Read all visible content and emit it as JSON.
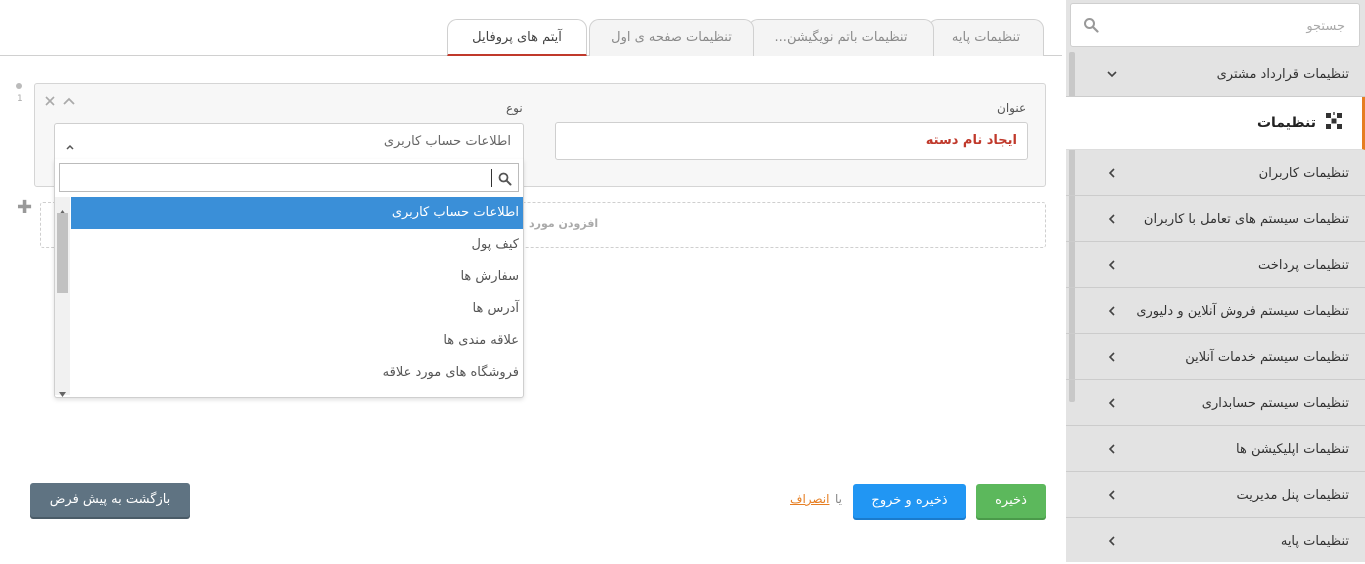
{
  "sidebar": {
    "search_placeholder": "جستجو",
    "items": [
      {
        "label": "تنظیمات قرارداد مشتری"
      },
      {
        "label": "تنظیمات"
      },
      {
        "label": "تنظیمات کاربران"
      },
      {
        "label": "تنظیمات سیستم های تعامل با کاربران"
      },
      {
        "label": "تنظیمات پرداخت"
      },
      {
        "label": "تنظیمات سیستم فروش آنلاین و دلیوری"
      },
      {
        "label": "تنظیمات سیستم خدمات آنلاین"
      },
      {
        "label": "تنظیمات سیستم حسابداری"
      },
      {
        "label": "تنظیمات اپلیکیشن ها"
      },
      {
        "label": "تنظیمات پنل مدیریت"
      },
      {
        "label": "تنظیمات پایه"
      }
    ],
    "accent_color": "#e67e22"
  },
  "tabs": [
    {
      "label": "تنظیمات پایه"
    },
    {
      "label": "تنظیمات باتم نویگیشن..."
    },
    {
      "label": "تنظیمات صفحه ی اول"
    },
    {
      "label": "آیتم های پروفایل"
    }
  ],
  "form": {
    "title_label": "عنوان",
    "title_value": "ایجاد نام دسته",
    "type_label": "نوع",
    "type_value": "اطلاعات حساب کاربری",
    "row_index": "1",
    "add_item_label": "افزودن مورد",
    "options": [
      "اطلاعات حساب کاربری",
      "کیف پول",
      "سفارش ها",
      "آدرس ها",
      "علاقه مندی ها",
      "فروشگاه های مورد علاقه"
    ]
  },
  "actions": {
    "save": "ذخیره",
    "save_exit": "ذخیره و خروج",
    "or": "یا",
    "cancel": "انصراف",
    "reset": "بازگشت به پیش فرض"
  }
}
